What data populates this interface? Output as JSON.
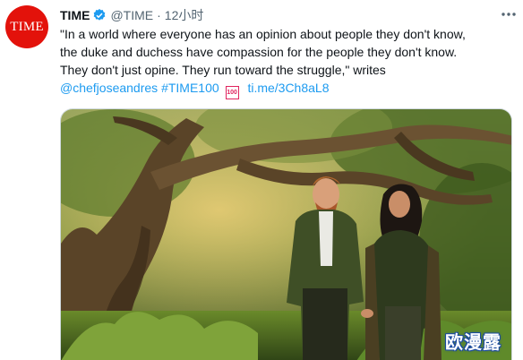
{
  "tweet": {
    "avatar_text": "TIME",
    "name": "TIME",
    "handle": "@TIME",
    "separator": "·",
    "time": "12小时",
    "text": "\"In a world where everyone has an opinion about people they don't know,\nthe duke and duchess have compassion for the people they don't know.\nThey don't just opine. They run toward the struggle,\" writes",
    "links": {
      "mention": "@chefjoseandres",
      "hashtag": "#TIME100",
      "emoji": "100",
      "url": "ti.me/3Ch8aL8"
    },
    "media_icon": "photo",
    "colors": {
      "link": "#1d9bf0",
      "brand": "#e3120b",
      "verified": "#1d9bf0"
    }
  },
  "watermark": "欧漫露"
}
